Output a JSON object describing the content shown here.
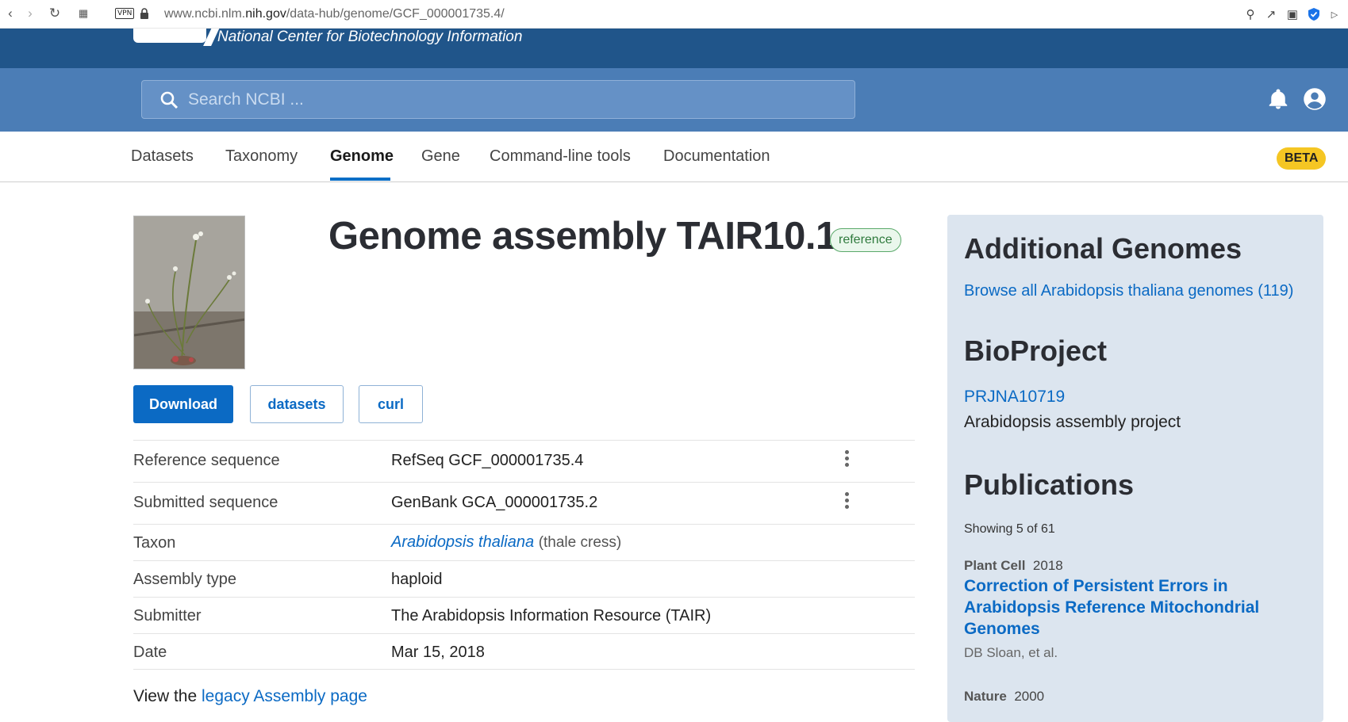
{
  "browser": {
    "url_prefix": "www.ncbi.nlm.",
    "url_domain": "nih.gov",
    "url_path": "/data-hub/genome/GCF_000001735.4/",
    "vpn_label": "VPN"
  },
  "header": {
    "org_name": "National Center for Biotechnology Information",
    "search_placeholder": "Search NCBI ..."
  },
  "tabs": [
    {
      "label": "Datasets"
    },
    {
      "label": "Taxonomy"
    },
    {
      "label": "Genome",
      "active": true
    },
    {
      "label": "Gene"
    },
    {
      "label": "Command-line tools"
    },
    {
      "label": "Documentation"
    }
  ],
  "beta_label": "BETA",
  "main": {
    "title": "Genome assembly TAIR10.1",
    "badge": "reference",
    "buttons": {
      "download": "Download",
      "datasets": "datasets",
      "curl": "curl"
    },
    "rows": [
      {
        "label": "Reference sequence",
        "value": "RefSeq GCF_000001735.4"
      },
      {
        "label": "Submitted sequence",
        "value": "GenBank GCA_000001735.2"
      },
      {
        "label": "Taxon",
        "value_link": "Arabidopsis thaliana",
        "value_extra": "(thale cress)"
      },
      {
        "label": "Assembly type",
        "value": "haploid"
      },
      {
        "label": "Submitter",
        "value": "The Arabidopsis Information Resource (TAIR)"
      },
      {
        "label": "Date",
        "value": "Mar 15, 2018"
      }
    ],
    "legacy_prefix": "View the ",
    "legacy_link": "legacy Assembly page"
  },
  "sidebar": {
    "additional_heading": "Additional Genomes",
    "browse_link": "Browse all Arabidopsis thaliana genomes (119)",
    "bioproject_heading": "BioProject",
    "bioproject_id": "PRJNA10719",
    "bioproject_desc": "Arabidopsis assembly project",
    "publications_heading": "Publications",
    "showing": "Showing 5 of 61",
    "publications": [
      {
        "journal": "Plant Cell",
        "year": "2018",
        "title": "Correction of Persistent Errors in Arabidopsis Reference Mitochondrial Genomes",
        "authors": "DB Sloan, et al."
      },
      {
        "journal": "Nature",
        "year": "2000"
      }
    ]
  }
}
